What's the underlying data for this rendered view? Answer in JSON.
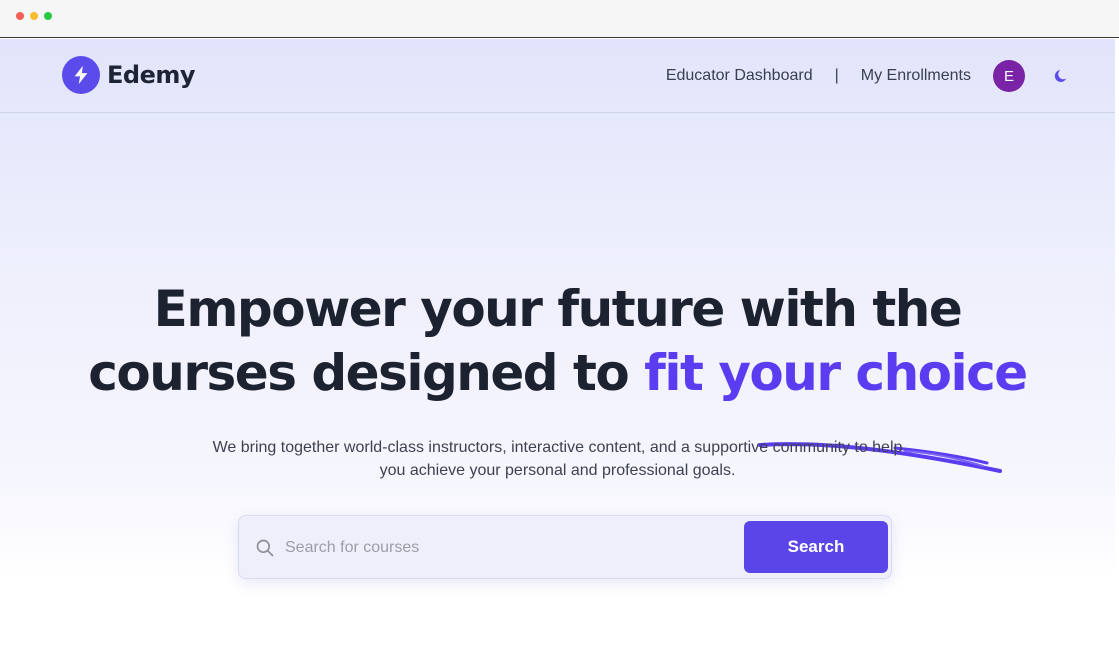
{
  "brand": {
    "name": "Edemy",
    "accent_color": "#5b4bea"
  },
  "nav": {
    "educator_dashboard": "Educator Dashboard",
    "separator": "|",
    "my_enrollments": "My Enrollments",
    "avatar_initial": "E",
    "theme_icon": "moon-icon"
  },
  "hero": {
    "title_line1": "Empower your future with the",
    "title_line2_plain": "courses designed to ",
    "title_line2_accent": "fit your choice",
    "subtitle_line1": "We bring together world-class instructors, interactive content, and a supportive community to help",
    "subtitle_line2": "you achieve your personal and professional goals."
  },
  "search": {
    "placeholder": "Search for courses",
    "value": "",
    "button_label": "Search",
    "icon": "search-icon"
  }
}
